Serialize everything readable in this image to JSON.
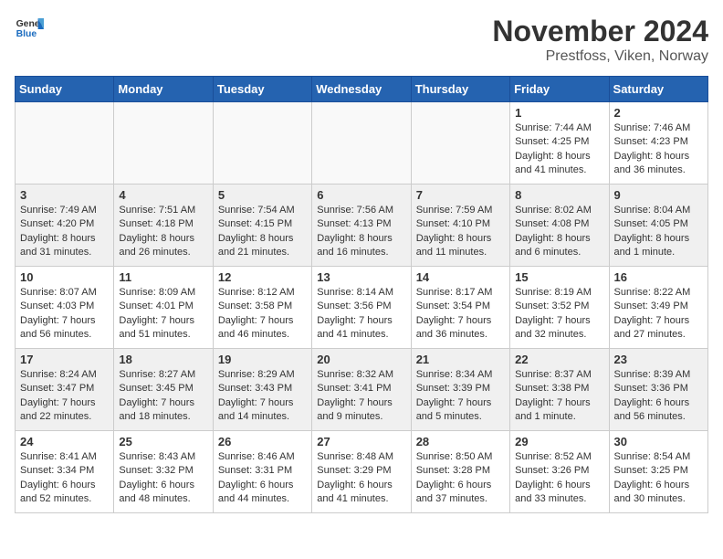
{
  "header": {
    "logo_general": "General",
    "logo_blue": "Blue",
    "month_title": "November 2024",
    "location": "Prestfoss, Viken, Norway"
  },
  "days_of_week": [
    "Sunday",
    "Monday",
    "Tuesday",
    "Wednesday",
    "Thursday",
    "Friday",
    "Saturday"
  ],
  "weeks": [
    [
      {
        "day": "",
        "info": ""
      },
      {
        "day": "",
        "info": ""
      },
      {
        "day": "",
        "info": ""
      },
      {
        "day": "",
        "info": ""
      },
      {
        "day": "",
        "info": ""
      },
      {
        "day": "1",
        "info": "Sunrise: 7:44 AM\nSunset: 4:25 PM\nDaylight: 8 hours and 41 minutes."
      },
      {
        "day": "2",
        "info": "Sunrise: 7:46 AM\nSunset: 4:23 PM\nDaylight: 8 hours and 36 minutes."
      }
    ],
    [
      {
        "day": "3",
        "info": "Sunrise: 7:49 AM\nSunset: 4:20 PM\nDaylight: 8 hours and 31 minutes."
      },
      {
        "day": "4",
        "info": "Sunrise: 7:51 AM\nSunset: 4:18 PM\nDaylight: 8 hours and 26 minutes."
      },
      {
        "day": "5",
        "info": "Sunrise: 7:54 AM\nSunset: 4:15 PM\nDaylight: 8 hours and 21 minutes."
      },
      {
        "day": "6",
        "info": "Sunrise: 7:56 AM\nSunset: 4:13 PM\nDaylight: 8 hours and 16 minutes."
      },
      {
        "day": "7",
        "info": "Sunrise: 7:59 AM\nSunset: 4:10 PM\nDaylight: 8 hours and 11 minutes."
      },
      {
        "day": "8",
        "info": "Sunrise: 8:02 AM\nSunset: 4:08 PM\nDaylight: 8 hours and 6 minutes."
      },
      {
        "day": "9",
        "info": "Sunrise: 8:04 AM\nSunset: 4:05 PM\nDaylight: 8 hours and 1 minute."
      }
    ],
    [
      {
        "day": "10",
        "info": "Sunrise: 8:07 AM\nSunset: 4:03 PM\nDaylight: 7 hours and 56 minutes."
      },
      {
        "day": "11",
        "info": "Sunrise: 8:09 AM\nSunset: 4:01 PM\nDaylight: 7 hours and 51 minutes."
      },
      {
        "day": "12",
        "info": "Sunrise: 8:12 AM\nSunset: 3:58 PM\nDaylight: 7 hours and 46 minutes."
      },
      {
        "day": "13",
        "info": "Sunrise: 8:14 AM\nSunset: 3:56 PM\nDaylight: 7 hours and 41 minutes."
      },
      {
        "day": "14",
        "info": "Sunrise: 8:17 AM\nSunset: 3:54 PM\nDaylight: 7 hours and 36 minutes."
      },
      {
        "day": "15",
        "info": "Sunrise: 8:19 AM\nSunset: 3:52 PM\nDaylight: 7 hours and 32 minutes."
      },
      {
        "day": "16",
        "info": "Sunrise: 8:22 AM\nSunset: 3:49 PM\nDaylight: 7 hours and 27 minutes."
      }
    ],
    [
      {
        "day": "17",
        "info": "Sunrise: 8:24 AM\nSunset: 3:47 PM\nDaylight: 7 hours and 22 minutes."
      },
      {
        "day": "18",
        "info": "Sunrise: 8:27 AM\nSunset: 3:45 PM\nDaylight: 7 hours and 18 minutes."
      },
      {
        "day": "19",
        "info": "Sunrise: 8:29 AM\nSunset: 3:43 PM\nDaylight: 7 hours and 14 minutes."
      },
      {
        "day": "20",
        "info": "Sunrise: 8:32 AM\nSunset: 3:41 PM\nDaylight: 7 hours and 9 minutes."
      },
      {
        "day": "21",
        "info": "Sunrise: 8:34 AM\nSunset: 3:39 PM\nDaylight: 7 hours and 5 minutes."
      },
      {
        "day": "22",
        "info": "Sunrise: 8:37 AM\nSunset: 3:38 PM\nDaylight: 7 hours and 1 minute."
      },
      {
        "day": "23",
        "info": "Sunrise: 8:39 AM\nSunset: 3:36 PM\nDaylight: 6 hours and 56 minutes."
      }
    ],
    [
      {
        "day": "24",
        "info": "Sunrise: 8:41 AM\nSunset: 3:34 PM\nDaylight: 6 hours and 52 minutes."
      },
      {
        "day": "25",
        "info": "Sunrise: 8:43 AM\nSunset: 3:32 PM\nDaylight: 6 hours and 48 minutes."
      },
      {
        "day": "26",
        "info": "Sunrise: 8:46 AM\nSunset: 3:31 PM\nDaylight: 6 hours and 44 minutes."
      },
      {
        "day": "27",
        "info": "Sunrise: 8:48 AM\nSunset: 3:29 PM\nDaylight: 6 hours and 41 minutes."
      },
      {
        "day": "28",
        "info": "Sunrise: 8:50 AM\nSunset: 3:28 PM\nDaylight: 6 hours and 37 minutes."
      },
      {
        "day": "29",
        "info": "Sunrise: 8:52 AM\nSunset: 3:26 PM\nDaylight: 6 hours and 33 minutes."
      },
      {
        "day": "30",
        "info": "Sunrise: 8:54 AM\nSunset: 3:25 PM\nDaylight: 6 hours and 30 minutes."
      }
    ]
  ]
}
